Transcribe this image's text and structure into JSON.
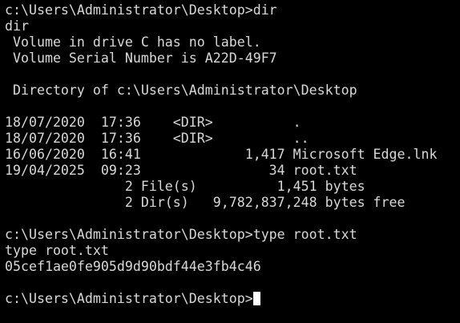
{
  "terminal": {
    "lines": [
      "c:\\Users\\Administrator\\Desktop>dir",
      "dir",
      " Volume in drive C has no label.",
      " Volume Serial Number is A22D-49F7",
      "",
      " Directory of c:\\Users\\Administrator\\Desktop",
      "",
      "18/07/2020  17:36    <DIR>          .",
      "18/07/2020  17:36    <DIR>          ..",
      "16/06/2020  16:41             1,417 Microsoft Edge.lnk",
      "19/04/2025  09:23                34 root.txt",
      "               2 File(s)          1,451 bytes",
      "               2 Dir(s)   9,782,837,248 bytes free",
      "",
      "c:\\Users\\Administrator\\Desktop>type root.txt",
      "type root.txt",
      "05cef1ae0fe905d9d90bdf44e3fb4c46",
      ""
    ],
    "prompt": "c:\\Users\\Administrator\\Desktop>",
    "cursor_color": "#ffffff",
    "text_color": "#d8d8d8",
    "background_color": "#000000"
  }
}
